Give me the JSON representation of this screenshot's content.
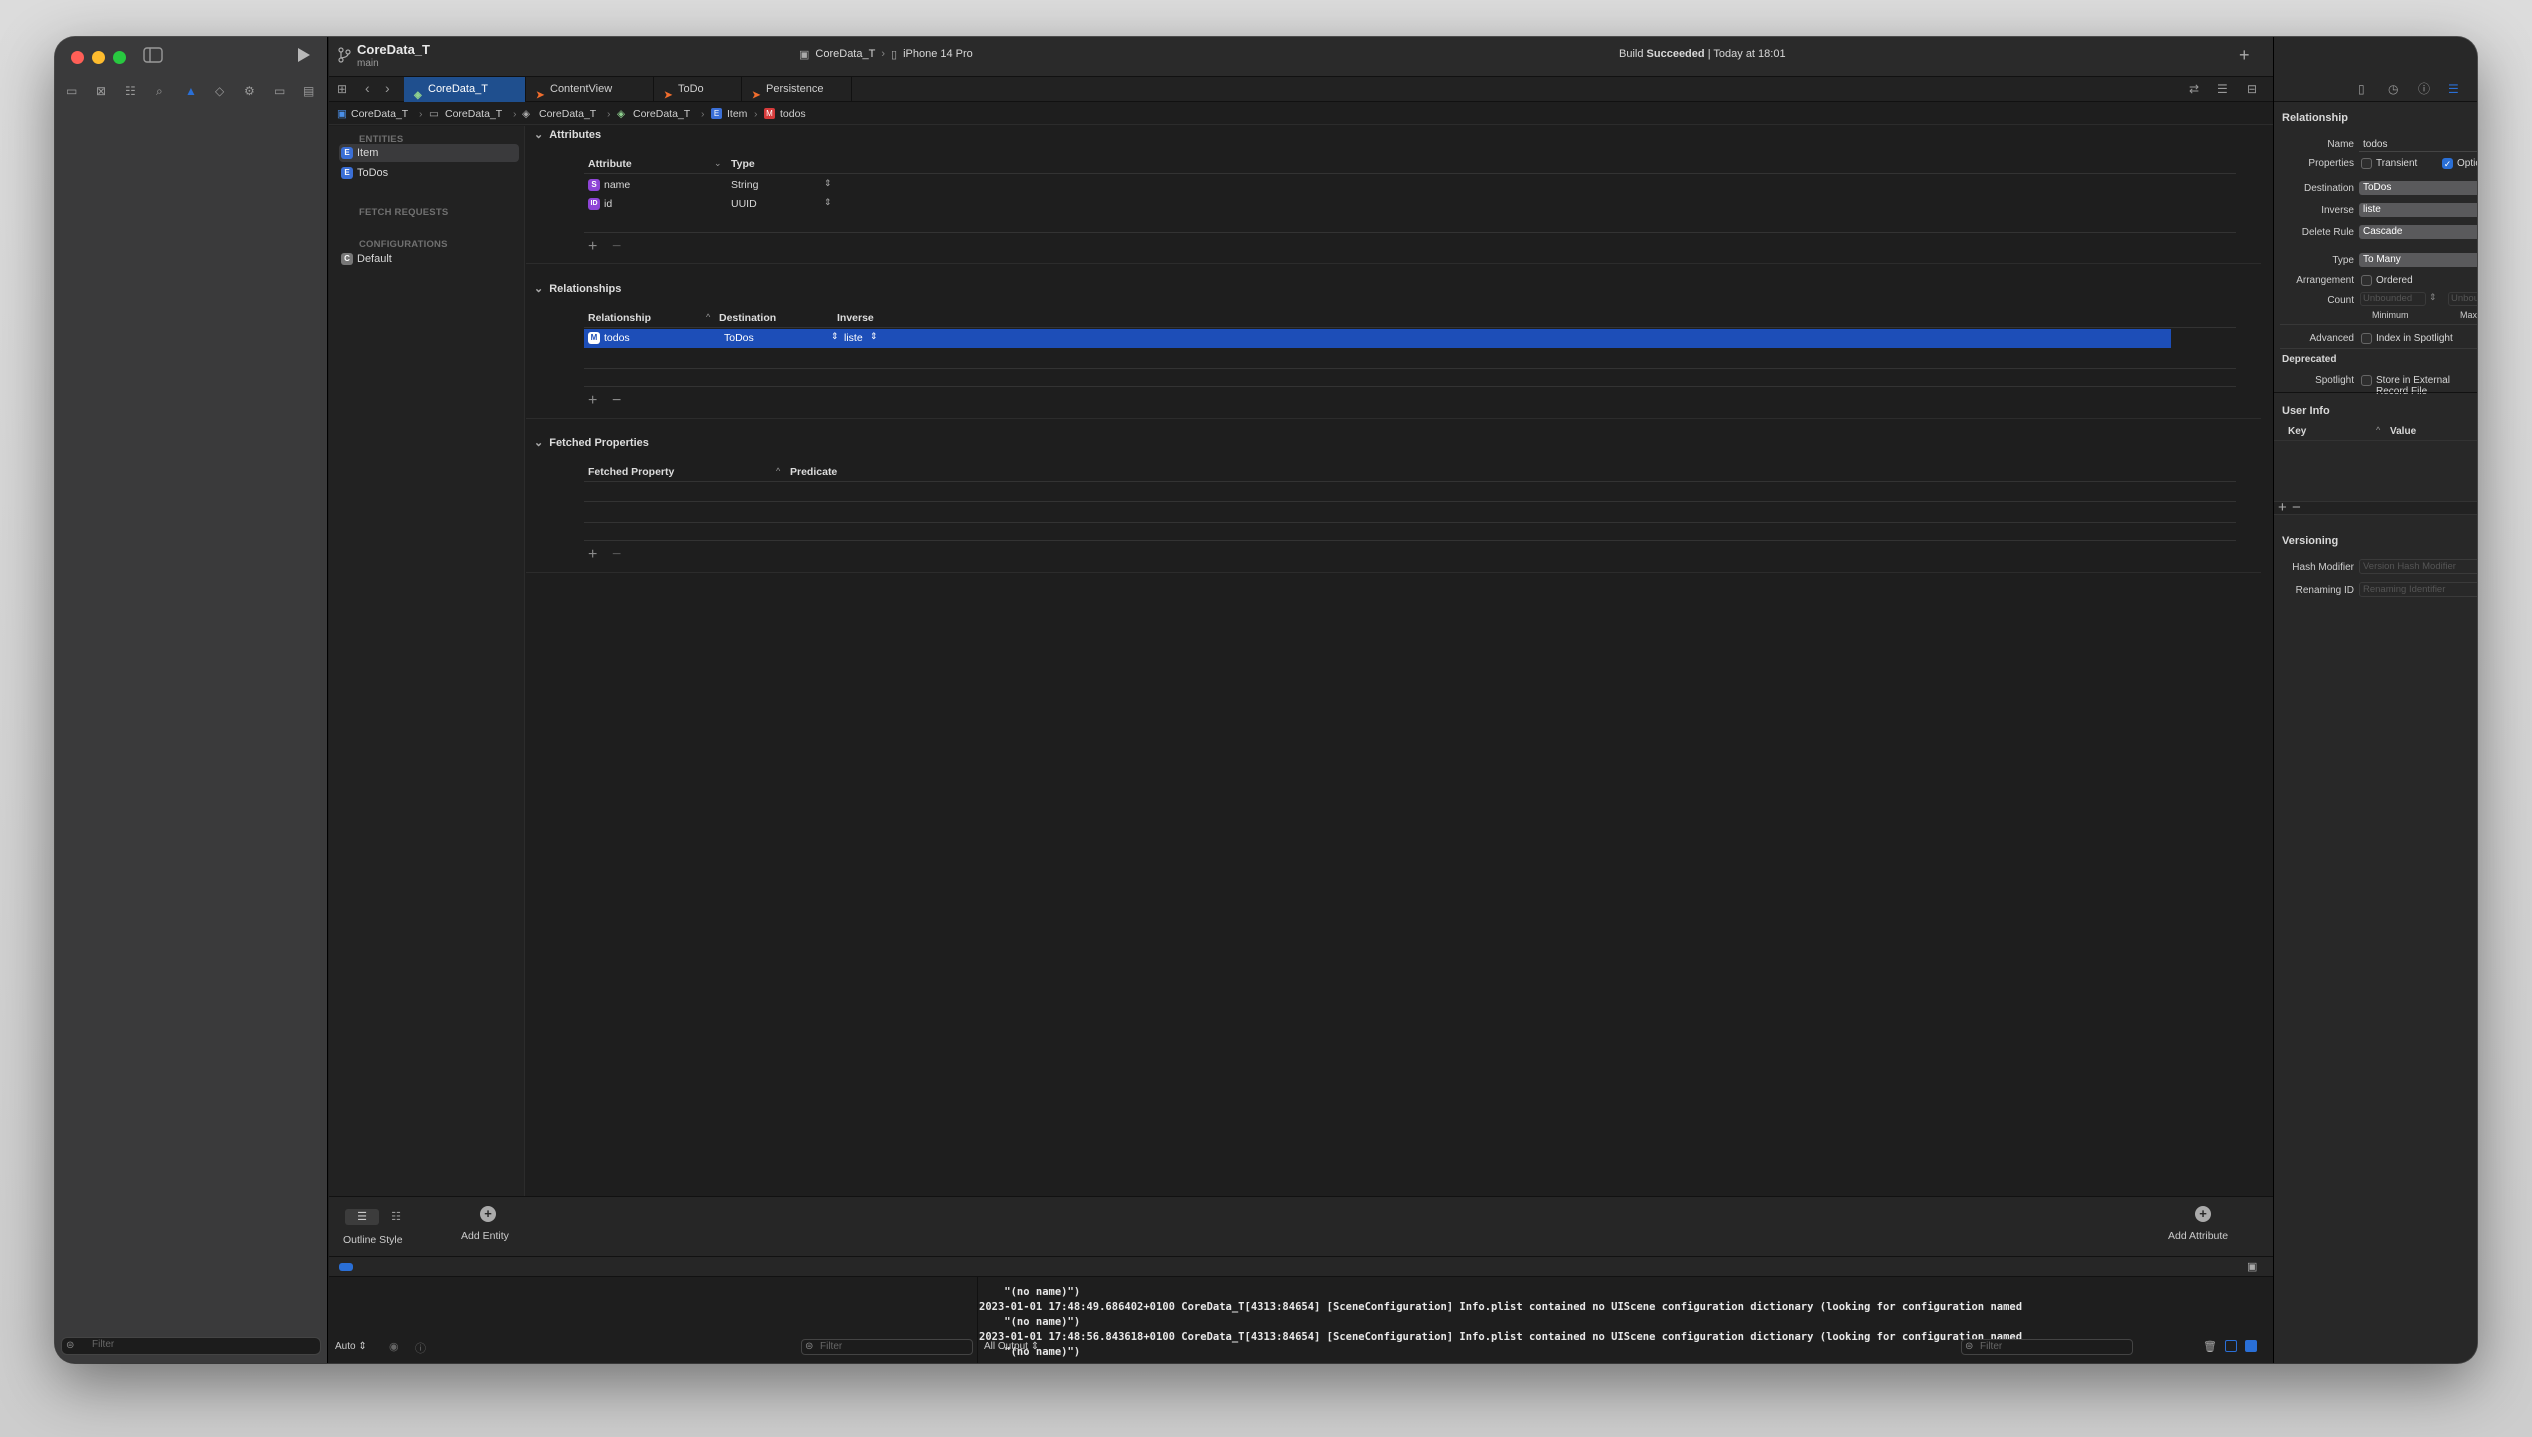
{
  "window": {
    "project": "CoreData_T",
    "branch": "main",
    "scheme": "CoreData_T",
    "device": "iPhone 14 Pro",
    "build_status_prefix": "Build",
    "build_status_bold": "Succeeded",
    "build_status_time": "Today at 18:01"
  },
  "tabs": [
    {
      "label": "CoreData_T",
      "active": true
    },
    {
      "label": "ContentView",
      "active": false
    },
    {
      "label": "ToDo",
      "active": false
    },
    {
      "label": "Persistence",
      "active": false
    }
  ],
  "breadcrumbs": [
    "CoreData_T",
    "CoreData_T",
    "CoreData_T",
    "CoreData_T",
    "Item",
    "todos"
  ],
  "entities_panel": {
    "entities_header": "ENTITIES",
    "entities": [
      "Item",
      "ToDos"
    ],
    "fetch_requests_header": "FETCH REQUESTS",
    "configurations_header": "CONFIGURATIONS",
    "configurations": [
      "Default"
    ]
  },
  "attributes": {
    "title": "Attributes",
    "col_attribute": "Attribute",
    "col_type": "Type",
    "rows": [
      {
        "badge": "S",
        "name": "name",
        "type": "String"
      },
      {
        "badge": "ID",
        "name": "id",
        "type": "UUID"
      }
    ]
  },
  "relationships": {
    "title": "Relationships",
    "col_relationship": "Relationship",
    "col_destination": "Destination",
    "col_inverse": "Inverse",
    "rows": [
      {
        "badge": "M",
        "name": "todos",
        "destination": "ToDos",
        "inverse": "liste"
      }
    ]
  },
  "fetched_properties": {
    "title": "Fetched Properties",
    "col_property": "Fetched Property",
    "col_predicate": "Predicate"
  },
  "bottom_bar": {
    "outline_style": "Outline Style",
    "add_entity": "Add Entity",
    "add_attribute": "Add Attribute"
  },
  "console": {
    "lines": [
      "    \"(no name)\")",
      "2023-01-01 17:48:49.686402+0100 CoreData_T[4313:84654] [SceneConfiguration] Info.plist contained no UIScene configuration dictionary (looking for configuration named",
      "    \"(no name)\")",
      "2023-01-01 17:48:56.843618+0100 CoreData_T[4313:84654] [SceneConfiguration] Info.plist contained no UIScene configuration dictionary (looking for configuration named",
      "    \"(no name)\")"
    ],
    "auto_label": "Auto",
    "output_label": "All Output",
    "filter_placeholder": "Filter"
  },
  "inspector": {
    "section_title": "Relationship",
    "name_label": "Name",
    "name_value": "todos",
    "properties_label": "Properties",
    "transient_label": "Transient",
    "transient_checked": false,
    "optional_label": "Optional",
    "optional_checked": true,
    "destination_label": "Destination",
    "destination_value": "ToDos",
    "inverse_label": "Inverse",
    "inverse_value": "liste",
    "delete_rule_label": "Delete Rule",
    "delete_rule_value": "Cascade",
    "type_label": "Type",
    "type_value": "To Many",
    "arrangement_label": "Arrangement",
    "ordered_label": "Ordered",
    "count_label": "Count",
    "count_min_placeholder": "Unbounded",
    "count_max_placeholder": "Unbounded",
    "minimum_label": "Minimum",
    "maximum_label": "Maximum",
    "advanced_label": "Advanced",
    "index_spotlight_label": "Index in Spotlight",
    "deprecated_label": "Deprecated",
    "spotlight_label": "Spotlight",
    "store_external_label": "Store in External Record File",
    "user_info_title": "User Info",
    "key_col": "Key",
    "value_col": "Value",
    "versioning_title": "Versioning",
    "hash_modifier_label": "Hash Modifier",
    "hash_modifier_placeholder": "Version Hash Modifier",
    "renaming_id_label": "Renaming ID",
    "renaming_id_placeholder": "Renaming Identifier"
  },
  "sidebar_filter_placeholder": "Filter",
  "colors": {
    "accent": "#1f5fce",
    "selection": "#1d4eb8",
    "close": "#ff5f57",
    "minimize": "#febc2e",
    "zoom": "#28c840",
    "swift": "#f06d2d"
  }
}
